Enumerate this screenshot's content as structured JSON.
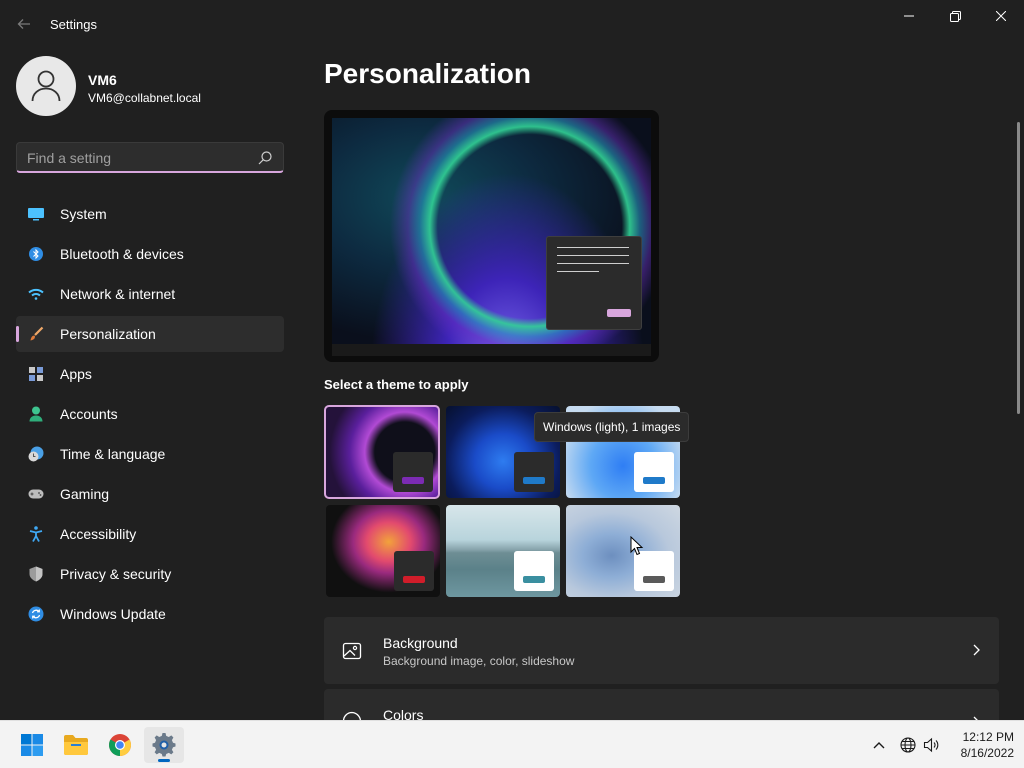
{
  "window": {
    "title": "Settings",
    "back_icon": "back-arrow-icon",
    "controls": [
      "minimize-icon",
      "maximize-icon",
      "close-icon"
    ]
  },
  "profile": {
    "name": "VM6",
    "email": "VM6@collabnet.local"
  },
  "search": {
    "placeholder": "Find a setting"
  },
  "sidebar": {
    "items": [
      {
        "label": "System",
        "icon": "system-icon",
        "active": false
      },
      {
        "label": "Bluetooth & devices",
        "icon": "bluetooth-icon",
        "active": false
      },
      {
        "label": "Network & internet",
        "icon": "wifi-icon",
        "active": false
      },
      {
        "label": "Personalization",
        "icon": "brush-icon",
        "active": true
      },
      {
        "label": "Apps",
        "icon": "apps-icon",
        "active": false
      },
      {
        "label": "Accounts",
        "icon": "person-icon",
        "active": false
      },
      {
        "label": "Time & language",
        "icon": "clock-globe-icon",
        "active": false
      },
      {
        "label": "Gaming",
        "icon": "gamepad-icon",
        "active": false
      },
      {
        "label": "Accessibility",
        "icon": "accessibility-icon",
        "active": false
      },
      {
        "label": "Privacy & security",
        "icon": "shield-icon",
        "active": false
      },
      {
        "label": "Windows Update",
        "icon": "update-icon",
        "active": false
      }
    ]
  },
  "main": {
    "title": "Personalization",
    "themes_label": "Select a theme to apply",
    "tooltip": "Windows (light), 1 images",
    "themes": [
      {
        "name": "theme-1",
        "selected": true,
        "accent": "#7b2bb3",
        "thumb_bg": "#2b2b2b"
      },
      {
        "name": "theme-2",
        "selected": false,
        "accent": "#1f7ac9",
        "thumb_bg": "#2b2b2b"
      },
      {
        "name": "theme-3",
        "selected": false,
        "accent": "#1f7ac9",
        "thumb_bg": "#ffffff"
      },
      {
        "name": "theme-4",
        "selected": false,
        "accent": "#d11d2a",
        "thumb_bg": "#2b2b2b"
      },
      {
        "name": "theme-5",
        "selected": false,
        "accent": "#3a8fa0",
        "thumb_bg": "#ffffff"
      },
      {
        "name": "theme-6",
        "selected": false,
        "accent": "#5a5a5a",
        "thumb_bg": "#ffffff"
      }
    ],
    "rows": [
      {
        "title": "Background",
        "subtitle": "Background image, color, slideshow",
        "icon": "image-icon"
      },
      {
        "title": "Colors",
        "subtitle": "",
        "icon": "palette-icon"
      }
    ]
  },
  "taskbar": {
    "apps": [
      "windows-start-icon",
      "file-explorer-icon",
      "chrome-icon",
      "settings-icon"
    ],
    "tray": [
      "chevron-up-icon",
      "globe-icon",
      "volume-icon"
    ],
    "time": "12:12 PM",
    "date": "8/16/2022"
  },
  "colors": {
    "accent": "#d8a6dd",
    "background": "#202020",
    "card": "#2b2b2b"
  }
}
